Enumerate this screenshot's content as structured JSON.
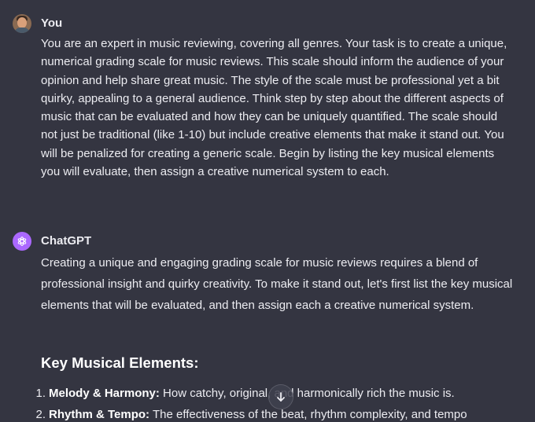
{
  "user_message": {
    "author": "You",
    "avatar": "user-avatar-photo",
    "text": "You are an expert in music reviewing, covering all genres. Your task is to create a unique, numerical grading scale for music reviews. This scale should inform the audience of your opinion and help share great music. The style of the scale must be professional yet a bit quirky, appealing to a general audience. Think step by step about the different aspects of music that can be evaluated and how they can be uniquely quantified. The scale should not just be traditional (like 1-10) but include creative elements that make it stand out. You will be penalized for creating a generic scale. Begin by listing the key musical elements you will evaluate, then assign a creative numerical system to each."
  },
  "assistant_message": {
    "author": "ChatGPT",
    "avatar": "openai-logo-icon",
    "avatar_color": "#ab68ff",
    "intro": "Creating a unique and engaging grading scale for music reviews requires a blend of professional insight and quirky creativity. To make it stand out, let's first list the key musical elements that will be evaluated, and then assign each a creative numerical system.",
    "heading": "Key Musical Elements:",
    "items": [
      {
        "number": "1.",
        "title": "Melody & Harmony:",
        "text": " How catchy, original, and harmonically rich the music is."
      },
      {
        "number": "2.",
        "title": "Rhythm & Tempo:",
        "text": " The effectiveness of the beat, rhythm complexity, and tempo"
      }
    ]
  },
  "scroll_button": {
    "icon": "arrow-down-icon"
  },
  "colors": {
    "background": "#343541",
    "text": "#ececf1"
  }
}
